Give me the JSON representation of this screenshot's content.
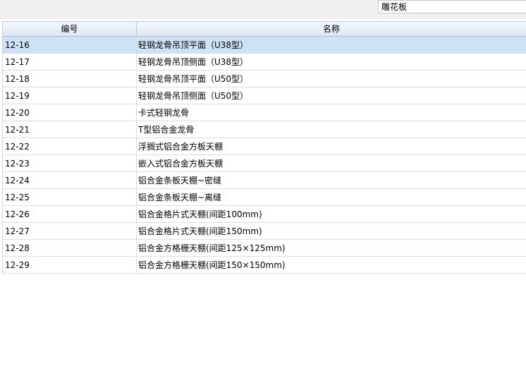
{
  "search": {
    "value": "雕花板"
  },
  "table": {
    "headers": {
      "code": "编号",
      "name": "名称"
    },
    "rows": [
      {
        "code": "12-16",
        "name": "轻钢龙骨吊顶平面（U38型）"
      },
      {
        "code": "12-17",
        "name": "轻钢龙骨吊顶侧面（U38型）"
      },
      {
        "code": "12-18",
        "name": "轻钢龙骨吊顶平面（U50型）"
      },
      {
        "code": "12-19",
        "name": "轻钢龙骨吊顶侧面（U50型）"
      },
      {
        "code": "12-20",
        "name": "卡式轻钢龙骨"
      },
      {
        "code": "12-21",
        "name": "T型铝合金龙骨"
      },
      {
        "code": "12-22",
        "name": "浮搁式铝合金方板天棚"
      },
      {
        "code": "12-23",
        "name": "嵌入式铝合金方板天棚"
      },
      {
        "code": "12-24",
        "name": "铝合金条板天棚~密缝"
      },
      {
        "code": "12-25",
        "name": "铝合金条板天棚~离缝"
      },
      {
        "code": "12-26",
        "name": "铝合金格片式天棚(间距100mm)"
      },
      {
        "code": "12-27",
        "name": "铝合金格片式天棚(间距150mm)"
      },
      {
        "code": "12-28",
        "name": "铝合金方格栅天棚(间距125×125mm)"
      },
      {
        "code": "12-29",
        "name": "铝合金方格栅天棚(间距150×150mm)"
      }
    ],
    "selected_index": 0
  }
}
